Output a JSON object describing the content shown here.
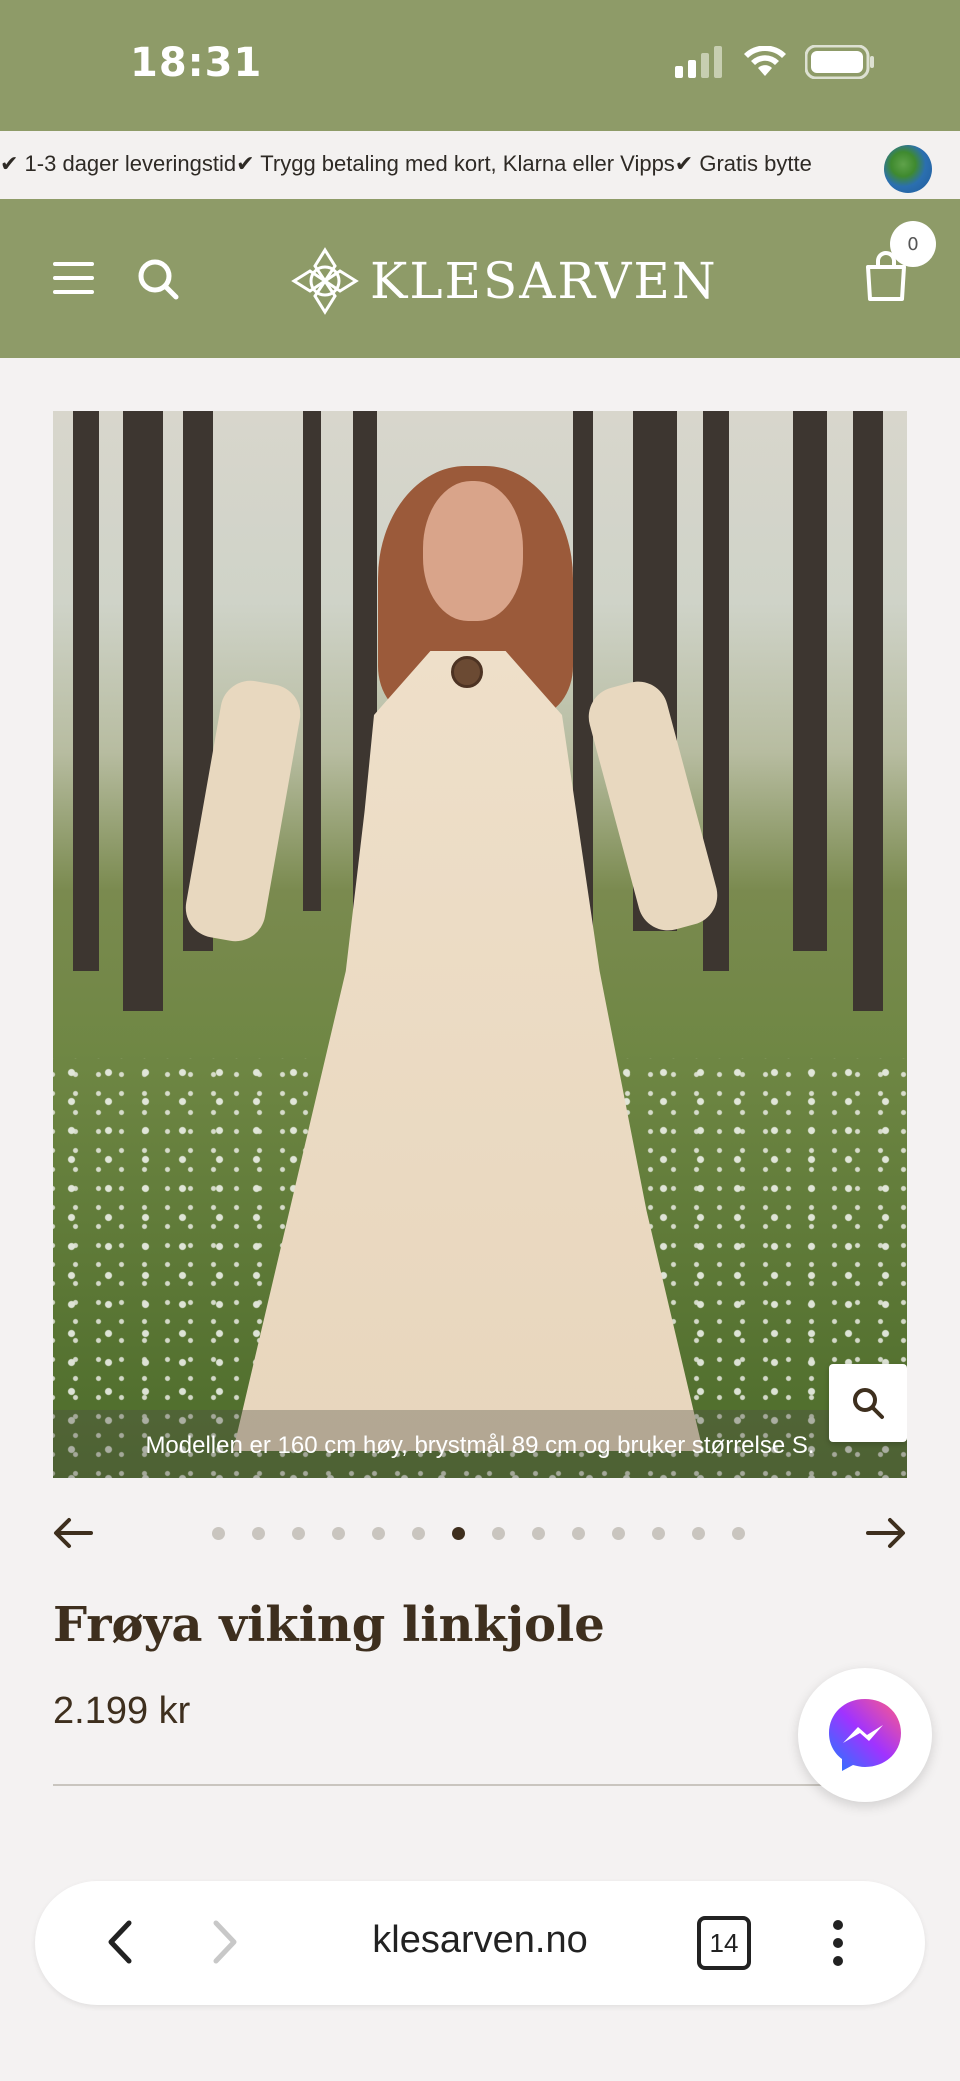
{
  "status": {
    "time": "18:31"
  },
  "announcement": {
    "text": "✔ 1-3 dager leveringstid✔ Trygg betaling med kort, Klarna eller Vipps✔ Gratis bytte"
  },
  "header": {
    "logo_text": "KLESARVEN",
    "cart_count": "0"
  },
  "product": {
    "image_caption": "Modellen er 160 cm høy, brystmål 89 cm og bruker størrelse S.",
    "title": "Frøya viking linkjole",
    "price": "2.199 kr",
    "gallery_count": 14,
    "gallery_active_index": 6
  },
  "browser": {
    "url": "klesarven.no",
    "tab_count": "14"
  },
  "colors": {
    "brand_green": "#8e9b68",
    "text_brown": "#3e2f1e",
    "background": "#f4f2f2"
  }
}
